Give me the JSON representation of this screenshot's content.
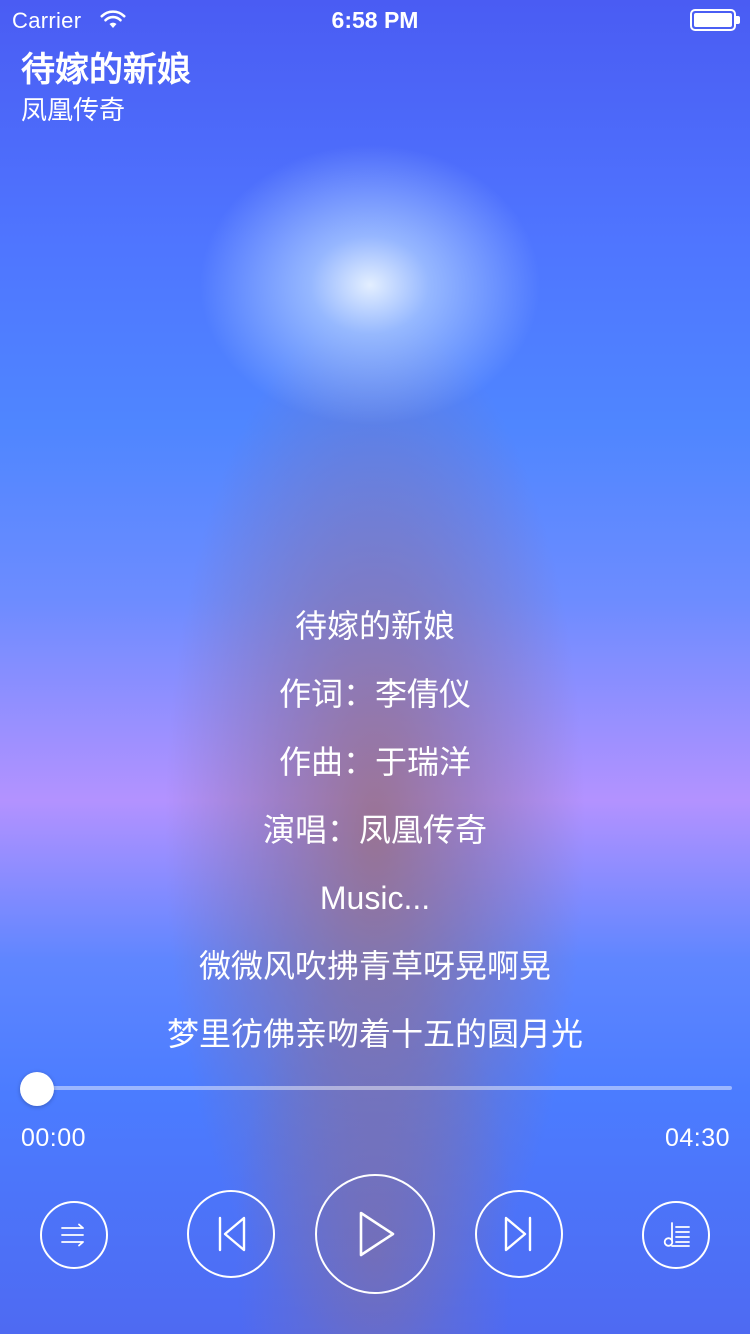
{
  "status_bar": {
    "carrier": "Carrier",
    "time": "6:58 PM",
    "wifi_icon": "wifi-icon",
    "battery_icon": "battery-icon"
  },
  "header": {
    "title": "待嫁的新娘",
    "artist": "凤凰传奇"
  },
  "lyrics": [
    "待嫁的新娘",
    "作词：李倩仪",
    "作曲：于瑞洋",
    "演唱：凤凰传奇",
    "Music...",
    "微微风吹拂青草呀晃啊晃",
    "梦里彷佛亲吻着十五的圆月光"
  ],
  "player": {
    "current_time": "00:00",
    "total_time": "04:30",
    "progress": 0
  },
  "controls": {
    "mode_icon": "shuffle-icon",
    "prev_icon": "previous-track-icon",
    "play_icon": "play-icon",
    "next_icon": "next-track-icon",
    "list_icon": "playlist-icon"
  },
  "colors": {
    "accent": "#ffffff",
    "background_top": "#4a5cf3",
    "background_mid": "#b392ff",
    "background_bottom": "#4e6af2"
  }
}
